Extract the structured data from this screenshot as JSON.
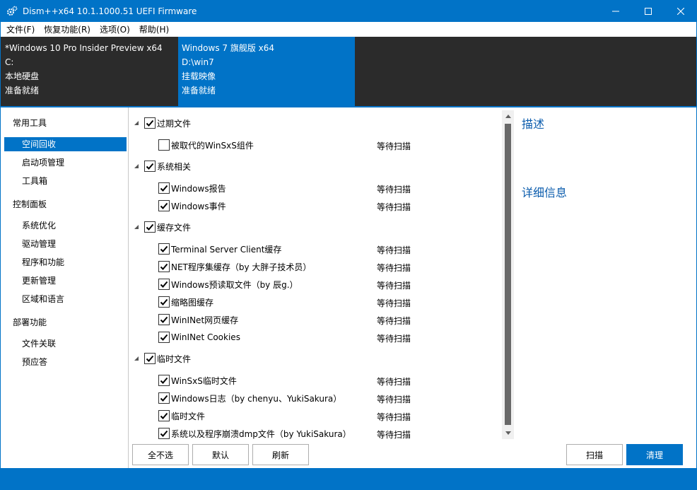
{
  "window": {
    "title": "Dism++x64 10.1.1000.51 UEFI Firmware",
    "accent_color": "#0173c7"
  },
  "menu": [
    {
      "label": "文件(F)"
    },
    {
      "label": "恢复功能(R)"
    },
    {
      "label": "选项(O)"
    },
    {
      "label": "帮助(H)"
    }
  ],
  "sessions": [
    {
      "name": "*Windows 10 Pro Insider Preview x64",
      "path": "C:",
      "type": "本地硬盘",
      "status": "准备就绪",
      "selected": false
    },
    {
      "name": "Windows 7 旗舰版 x64",
      "path": "D:\\win7",
      "type": "挂载映像",
      "status": "准备就绪",
      "selected": true
    }
  ],
  "sidebar": {
    "groups": [
      {
        "label": "常用工具",
        "items": [
          {
            "label": "空间回收",
            "selected": true
          },
          {
            "label": "启动项管理"
          },
          {
            "label": "工具箱"
          }
        ]
      },
      {
        "label": "控制面板",
        "items": [
          {
            "label": "系统优化"
          },
          {
            "label": "驱动管理"
          },
          {
            "label": "程序和功能"
          },
          {
            "label": "更新管理"
          },
          {
            "label": "区域和语言"
          }
        ]
      },
      {
        "label": "部署功能",
        "items": [
          {
            "label": "文件关联"
          },
          {
            "label": "预应答"
          }
        ]
      }
    ]
  },
  "cleanup": {
    "categories": [
      {
        "label": "过期文件",
        "checked": true,
        "items": [
          {
            "label": "被取代的WinSxS组件",
            "checked": false,
            "status": "等待扫描"
          }
        ]
      },
      {
        "label": "系统相关",
        "checked": true,
        "items": [
          {
            "label": "Windows报告",
            "checked": true,
            "status": "等待扫描"
          },
          {
            "label": "Windows事件",
            "checked": true,
            "status": "等待扫描"
          }
        ]
      },
      {
        "label": "缓存文件",
        "checked": true,
        "items": [
          {
            "label": "Terminal Server Client缓存",
            "checked": true,
            "status": "等待扫描"
          },
          {
            "label": "NET程序集缓存（by 大胖子技术员）",
            "checked": true,
            "status": "等待扫描"
          },
          {
            "label": "Windows预读取文件（by 辰g.）",
            "checked": true,
            "status": "等待扫描"
          },
          {
            "label": "缩略图缓存",
            "checked": true,
            "status": "等待扫描"
          },
          {
            "label": "WinINet网页缓存",
            "checked": true,
            "status": "等待扫描"
          },
          {
            "label": "WinINet Cookies",
            "checked": true,
            "status": "等待扫描"
          }
        ]
      },
      {
        "label": "临时文件",
        "checked": true,
        "items": [
          {
            "label": "WinSxS临时文件",
            "checked": true,
            "status": "等待扫描"
          },
          {
            "label": "Windows日志（by chenyu、YukiSakura）",
            "checked": true,
            "status": "等待扫描"
          },
          {
            "label": "临时文件",
            "checked": true,
            "status": "等待扫描"
          },
          {
            "label": "系统以及程序崩溃dmp文件（by YukiSakura）",
            "checked": true,
            "status": "等待扫描"
          }
        ]
      }
    ]
  },
  "details": {
    "description_heading": "描述",
    "info_heading": "详细信息"
  },
  "buttons": {
    "select_none": "全不选",
    "default": "默认",
    "refresh": "刷新",
    "scan": "扫描",
    "clean": "清理"
  }
}
